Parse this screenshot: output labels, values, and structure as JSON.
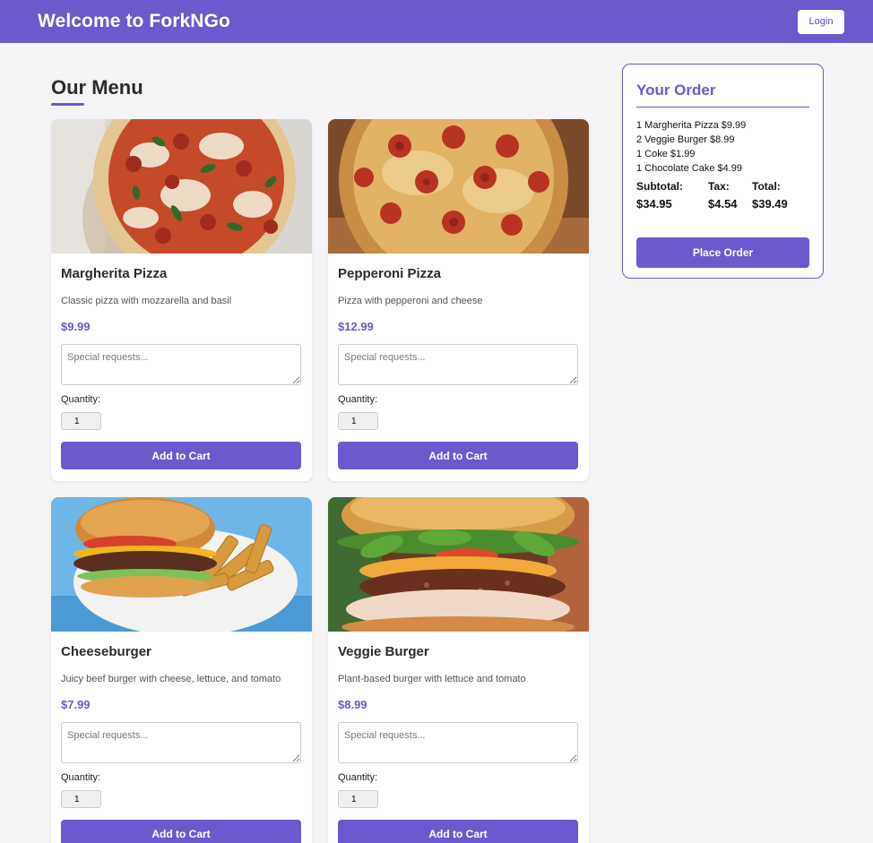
{
  "header": {
    "title": "Welcome to ForkNGo",
    "login_label": "Login"
  },
  "menu": {
    "title": "Our Menu",
    "special_placeholder": "Special requests...",
    "quantity_label": "Quantity:",
    "add_label": "Add to Cart",
    "items": [
      {
        "name": "Margherita Pizza",
        "description": "Classic pizza with mozzarella and basil",
        "price": "$9.99",
        "quantity": "1",
        "image": "margherita-pizza-image"
      },
      {
        "name": "Pepperoni Pizza",
        "description": "Pizza with pepperoni and cheese",
        "price": "$12.99",
        "quantity": "1",
        "image": "pepperoni-pizza-image"
      },
      {
        "name": "Cheeseburger",
        "description": "Juicy beef burger with cheese, lettuce, and tomato",
        "price": "$7.99",
        "quantity": "1",
        "image": "cheeseburger-image"
      },
      {
        "name": "Veggie Burger",
        "description": "Plant-based burger with lettuce and tomato",
        "price": "$8.99",
        "quantity": "1",
        "image": "veggie-burger-image"
      }
    ]
  },
  "order": {
    "title": "Your Order",
    "lines": [
      "1 Margherita Pizza $9.99",
      "2 Veggie Burger $8.99",
      "1 Coke $1.99",
      "1 Chocolate Cake $4.99"
    ],
    "subtotal_label": "Subtotal:",
    "subtotal": "$34.95",
    "tax_label": "Tax:",
    "tax": "$4.54",
    "total_label": "Total:",
    "total": "$39.49",
    "place_label": "Place Order"
  },
  "colors": {
    "accent": "#6a5acd",
    "background": "#f4f4f6"
  }
}
